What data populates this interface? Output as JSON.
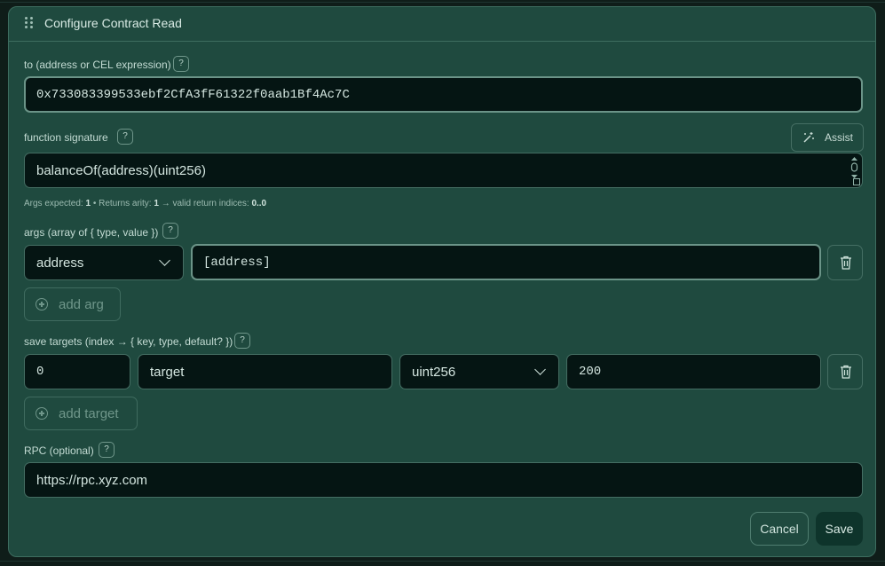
{
  "modal": {
    "title": "Configure Contract Read"
  },
  "to_field": {
    "label": "to (address or CEL expression)",
    "value": "0x733083399533ebf2CfA3fF61322f0aab1Bf4Ac7C"
  },
  "function_signature": {
    "label": "function signature",
    "value": "balanceOf(address)(uint256)",
    "assist_label": "Assist",
    "hint": {
      "prefix": "Args expected:",
      "args_count": "1",
      "middle": "• Returns arity:",
      "returns_count": "1",
      "suffix": "→ valid return indices:",
      "indices": "0..0"
    }
  },
  "args": {
    "label": "args (array of { type, value })",
    "rows": [
      {
        "type": "address",
        "value": "[address]"
      }
    ],
    "add_label": "add arg"
  },
  "save_targets": {
    "label": "save targets (index → { key, type, default? })",
    "rows": [
      {
        "index": "0",
        "key": "target",
        "type": "uint256",
        "default": "200"
      }
    ],
    "add_label": "add target"
  },
  "rpc": {
    "label": "RPC (optional)",
    "value": "https://rpc.xyz.com"
  },
  "footer": {
    "cancel_label": "Cancel",
    "save_label": "Save"
  },
  "help_glyph": "?",
  "icons": {
    "drag": "drag-handle-icon",
    "help": "help-icon",
    "assist": "magic-wand-icon",
    "trash": "trash-icon",
    "add": "plus-circle-icon",
    "chevron": "chevron-down-icon"
  }
}
